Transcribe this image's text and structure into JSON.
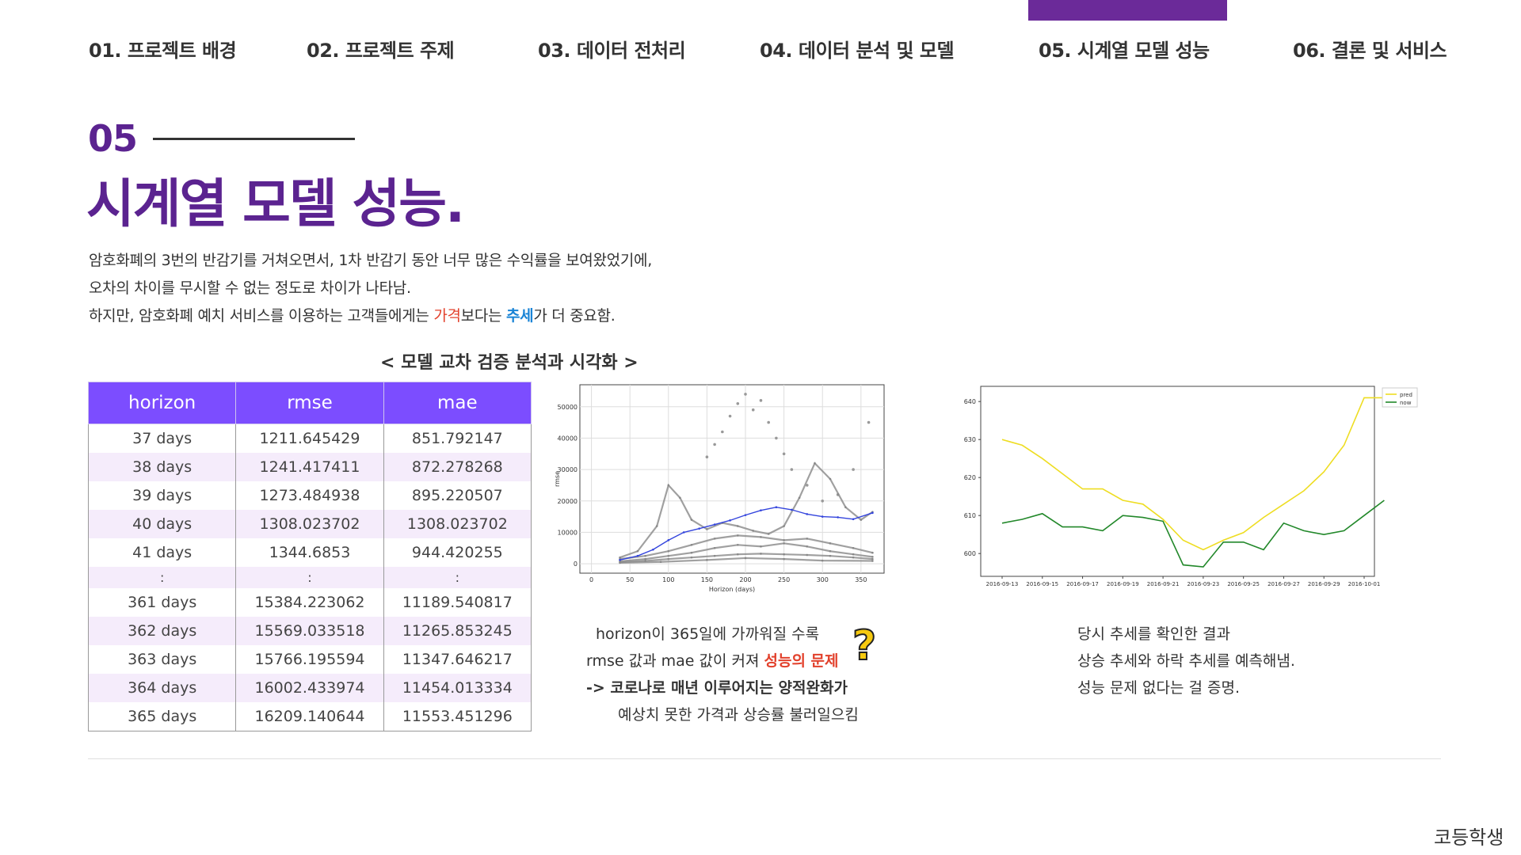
{
  "nav": {
    "items": [
      "01. 프로젝트 배경",
      "02. 프로젝트 주제",
      "03. 데이터 전처리",
      "04. 데이터 분석 및 모델",
      "05. 시계열 모델 성능",
      "06. 결론 및 서비스"
    ],
    "active_index": 4,
    "accent_color": "#6b2a99"
  },
  "section": {
    "number": "05",
    "title": "시계열 모델 성능.",
    "title_color": "#5b2390"
  },
  "description": {
    "line1": "암호화폐의 3번의 반감기를 거쳐오면서, 1차 반감기 동안 너무 많은 수익률을 보여왔었기에,",
    "line2": "오차의 차이를 무시할 수 없는 정도로 차이가 나타남.",
    "line3_part1": "하지만, 암호화폐 예치 서비스를 이용하는 고객들에게는 ",
    "line3_red": "가격",
    "line3_part2": "보다는 ",
    "line3_blue": "추세",
    "line3_part3": "가 더 중요함."
  },
  "cv_title": "< 모델 교차 검증 분석과 시각화 >",
  "table": {
    "header_color": "#7c4dff",
    "headers": [
      "horizon",
      "rmse",
      "mae"
    ],
    "rows": [
      [
        "37 days",
        "1211.645429",
        "851.792147"
      ],
      [
        "38 days",
        "1241.417411",
        "872.278268"
      ],
      [
        "39 days",
        "1273.484938",
        "895.220507"
      ],
      [
        "40 days",
        "1308.023702",
        "1308.023702"
      ],
      [
        "41 days",
        "1344.6853",
        "944.420255"
      ],
      [
        ":",
        ":",
        ":"
      ],
      [
        "361 days",
        "15384.223062",
        "11189.540817"
      ],
      [
        "362 days",
        "15569.033518",
        "11265.853245"
      ],
      [
        "363 days",
        "15766.195594",
        "11347.646217"
      ],
      [
        "364 days",
        "16002.433974",
        "11454.013334"
      ],
      [
        "365 days",
        "16209.140644",
        "11553.451296"
      ]
    ]
  },
  "chart_data": [
    {
      "type": "line",
      "xlabel": "Horizon (days)",
      "ylabel": "rmse",
      "xticks": [
        0,
        50,
        100,
        150,
        200,
        250,
        300,
        350
      ],
      "yticks": [
        0,
        10000,
        20000,
        30000,
        40000,
        50000
      ],
      "xlim": [
        -15,
        380
      ],
      "ylim": [
        -3000,
        57000
      ],
      "grid": true,
      "series": [
        {
          "color": "#3344dd",
          "x": [
            37,
            60,
            80,
            100,
            120,
            140,
            160,
            180,
            200,
            220,
            240,
            260,
            280,
            300,
            320,
            340,
            365
          ],
          "y": [
            1200,
            2500,
            4500,
            7500,
            10000,
            11200,
            12500,
            13800,
            15500,
            17000,
            18000,
            17200,
            15800,
            15000,
            14800,
            14200,
            16200
          ]
        },
        {
          "color": "#888888",
          "x": [
            37,
            60,
            85,
            100,
            115,
            130,
            150,
            170,
            190,
            210,
            230,
            250,
            270,
            290,
            310,
            330,
            350,
            365
          ],
          "y": [
            2000,
            4000,
            12000,
            25000,
            21000,
            14000,
            11000,
            13000,
            12000,
            10500,
            9500,
            12000,
            21000,
            32000,
            27000,
            18000,
            14000,
            16500
          ]
        },
        {
          "color": "#888888",
          "x": [
            37,
            70,
            100,
            130,
            160,
            190,
            220,
            250,
            280,
            310,
            340,
            365
          ],
          "y": [
            1500,
            2500,
            4000,
            6000,
            8000,
            9000,
            8500,
            7500,
            8000,
            6500,
            5000,
            3500
          ]
        },
        {
          "color": "#888888",
          "x": [
            37,
            70,
            100,
            130,
            160,
            190,
            220,
            250,
            280,
            310,
            340,
            365
          ],
          "y": [
            800,
            1500,
            2500,
            3500,
            5000,
            6000,
            5500,
            6500,
            5500,
            4000,
            3000,
            2200
          ]
        },
        {
          "color": "#888888",
          "x": [
            37,
            70,
            100,
            130,
            160,
            190,
            220,
            250,
            280,
            310,
            340,
            365
          ],
          "y": [
            500,
            900,
            1500,
            2000,
            2500,
            3000,
            3200,
            3000,
            2800,
            2500,
            2000,
            1500
          ]
        },
        {
          "color": "#888888",
          "x": [
            37,
            90,
            150,
            200,
            250,
            300,
            365
          ],
          "y": [
            300,
            600,
            1200,
            1800,
            1500,
            1000,
            900
          ]
        }
      ],
      "scatter_series": [
        {
          "color": "#999999",
          "x": [
            150,
            160,
            170,
            180,
            190,
            200,
            210,
            220,
            230,
            240,
            250,
            260,
            280,
            300,
            320,
            340,
            360
          ],
          "y": [
            34000,
            38000,
            42000,
            47000,
            51000,
            54000,
            49000,
            52000,
            45000,
            40000,
            35000,
            30000,
            25000,
            20000,
            22000,
            30000,
            45000
          ]
        }
      ]
    },
    {
      "type": "line",
      "xlabel": "",
      "ylabel": "",
      "categories": [
        "2016-09-13",
        "2016-09-15",
        "2016-09-17",
        "2016-09-19",
        "2016-09-21",
        "2016-09-23",
        "2016-09-25",
        "2016-09-27",
        "2016-09-29",
        "2016-10-01"
      ],
      "yticks": [
        600,
        610,
        620,
        630,
        640
      ],
      "ylim": [
        594,
        644
      ],
      "grid": false,
      "legend": "top-right",
      "series": [
        {
          "name": "pred",
          "color": "#eedd22",
          "x": [
            0,
            0.5,
            1,
            1.5,
            2,
            2.5,
            3,
            3.5,
            4,
            4.5,
            5,
            5.5,
            6,
            6.5,
            7,
            7.5,
            8,
            8.5,
            9,
            9.5
          ],
          "y": [
            630,
            628.5,
            625,
            621,
            617,
            617,
            614,
            613,
            609,
            603.5,
            601,
            603.5,
            605.5,
            609.5,
            613,
            616.5,
            621.5,
            628.5,
            641,
            641
          ]
        },
        {
          "name": "now",
          "color": "#22882a",
          "x": [
            0,
            0.5,
            1,
            1.5,
            2,
            2.5,
            3,
            3.5,
            4,
            4.5,
            5,
            5.5,
            6,
            6.5,
            7,
            7.5,
            8,
            8.5,
            9,
            9.5
          ],
          "y": [
            608,
            609,
            610.5,
            607,
            607,
            606,
            610,
            609.5,
            608.5,
            597,
            596.5,
            603,
            603,
            601,
            608,
            606,
            605,
            606,
            610,
            614
          ]
        }
      ]
    }
  ],
  "caption_left": {
    "line1": "horizon이 365일에 가까워질 수록",
    "line2_part1": "rmse 값과 mae 값이 커져 ",
    "line2_red": "성능의 문제",
    "line3": "-> 코로나로 매년 이루어지는 양적완화가",
    "line4": "예상치 못한 가격과 상승률 불러일으킴",
    "qmark": "?"
  },
  "caption_right": {
    "line1": "당시 추세를 확인한 결과",
    "line2": "상승 추세와 하락 추세를 예측해냄.",
    "line3": "성능 문제 없다는 걸 증명."
  },
  "brand": "코등학생"
}
